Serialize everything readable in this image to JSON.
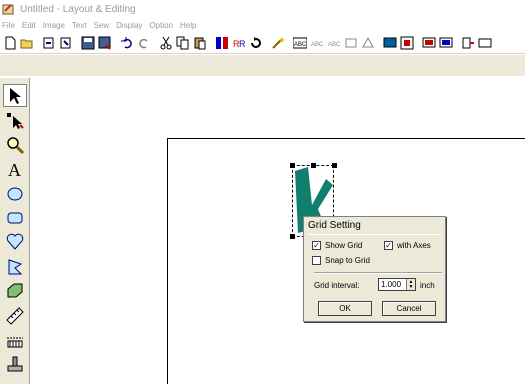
{
  "window": {
    "title": "Untitled - Layout & Editing"
  },
  "menu": [
    "File",
    "Edit",
    "Image",
    "Text",
    "Sew",
    "Display",
    "Option",
    "Help"
  ],
  "dialog": {
    "title": "Grid Setting",
    "show_grid_label": "Show Grid",
    "with_axes_label": "with Axes",
    "snap_to_grid_label": "Snap to Grid",
    "grid_interval_label": "Grid interval:",
    "grid_interval_value": "1.000",
    "grid_interval_unit": "inch",
    "ok_label": "OK",
    "cancel_label": "Cancel",
    "show_grid_checked": true,
    "with_axes_checked": true,
    "snap_to_grid_checked": false
  },
  "colors": {
    "design_fill": "#127f6e",
    "panel_bg": "#ece9d8"
  }
}
